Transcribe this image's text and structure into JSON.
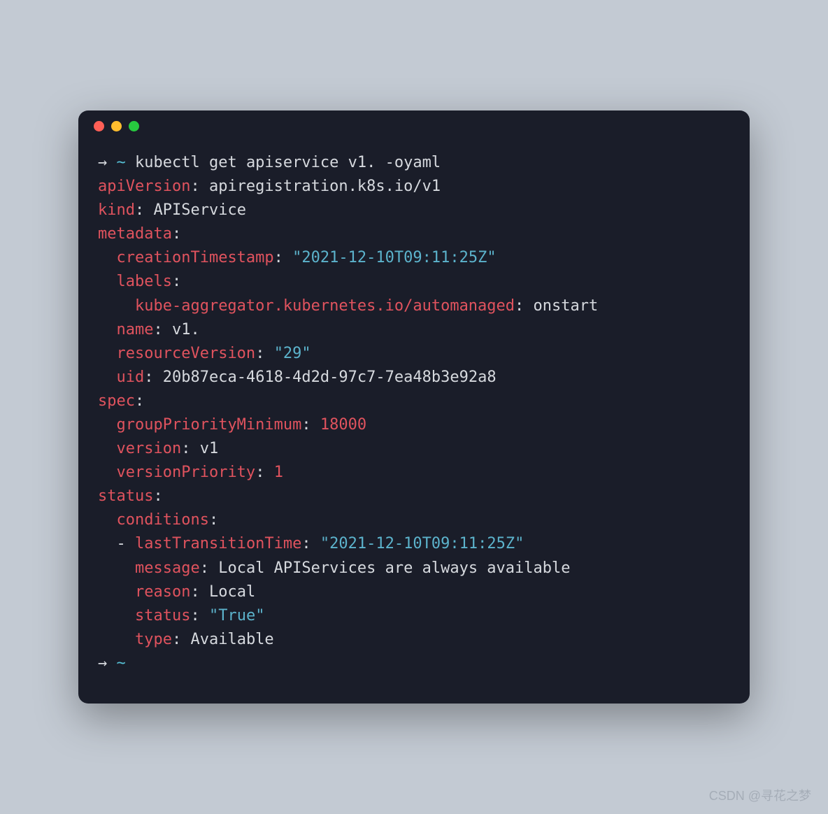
{
  "prompt1": {
    "arrow": "→",
    "tilde": "~",
    "command": "kubectl get apiservice v1. -oyaml"
  },
  "yaml": {
    "apiVersion_key": "apiVersion",
    "apiVersion_val": "apiregistration.k8s.io/v1",
    "kind_key": "kind",
    "kind_val": "APIService",
    "metadata_key": "metadata",
    "creationTimestamp_key": "creationTimestamp",
    "creationTimestamp_val": "\"2021-12-10T09:11:25Z\"",
    "labels_key": "labels",
    "automanaged_key": "kube-aggregator.kubernetes.io/automanaged",
    "automanaged_val": "onstart",
    "name_key": "name",
    "name_val": "v1.",
    "resourceVersion_key": "resourceVersion",
    "resourceVersion_val": "\"29\"",
    "uid_key": "uid",
    "uid_val": "20b87eca-4618-4d2d-97c7-7ea48b3e92a8",
    "spec_key": "spec",
    "groupPriorityMinimum_key": "groupPriorityMinimum",
    "groupPriorityMinimum_val": "18000",
    "version_key": "version",
    "version_val": "v1",
    "versionPriority_key": "versionPriority",
    "versionPriority_val": "1",
    "status_key": "status",
    "conditions_key": "conditions",
    "dash": "-",
    "lastTransitionTime_key": "lastTransitionTime",
    "lastTransitionTime_val": "\"2021-12-10T09:11:25Z\"",
    "message_key": "message",
    "message_val": "Local APIServices are always available",
    "reason_key": "reason",
    "reason_val": "Local",
    "status_inner_key": "status",
    "status_inner_val": "\"True\"",
    "type_key": "type",
    "type_val": "Available"
  },
  "prompt2": {
    "arrow": "→",
    "tilde": "~"
  },
  "watermark": "CSDN @寻花之梦"
}
